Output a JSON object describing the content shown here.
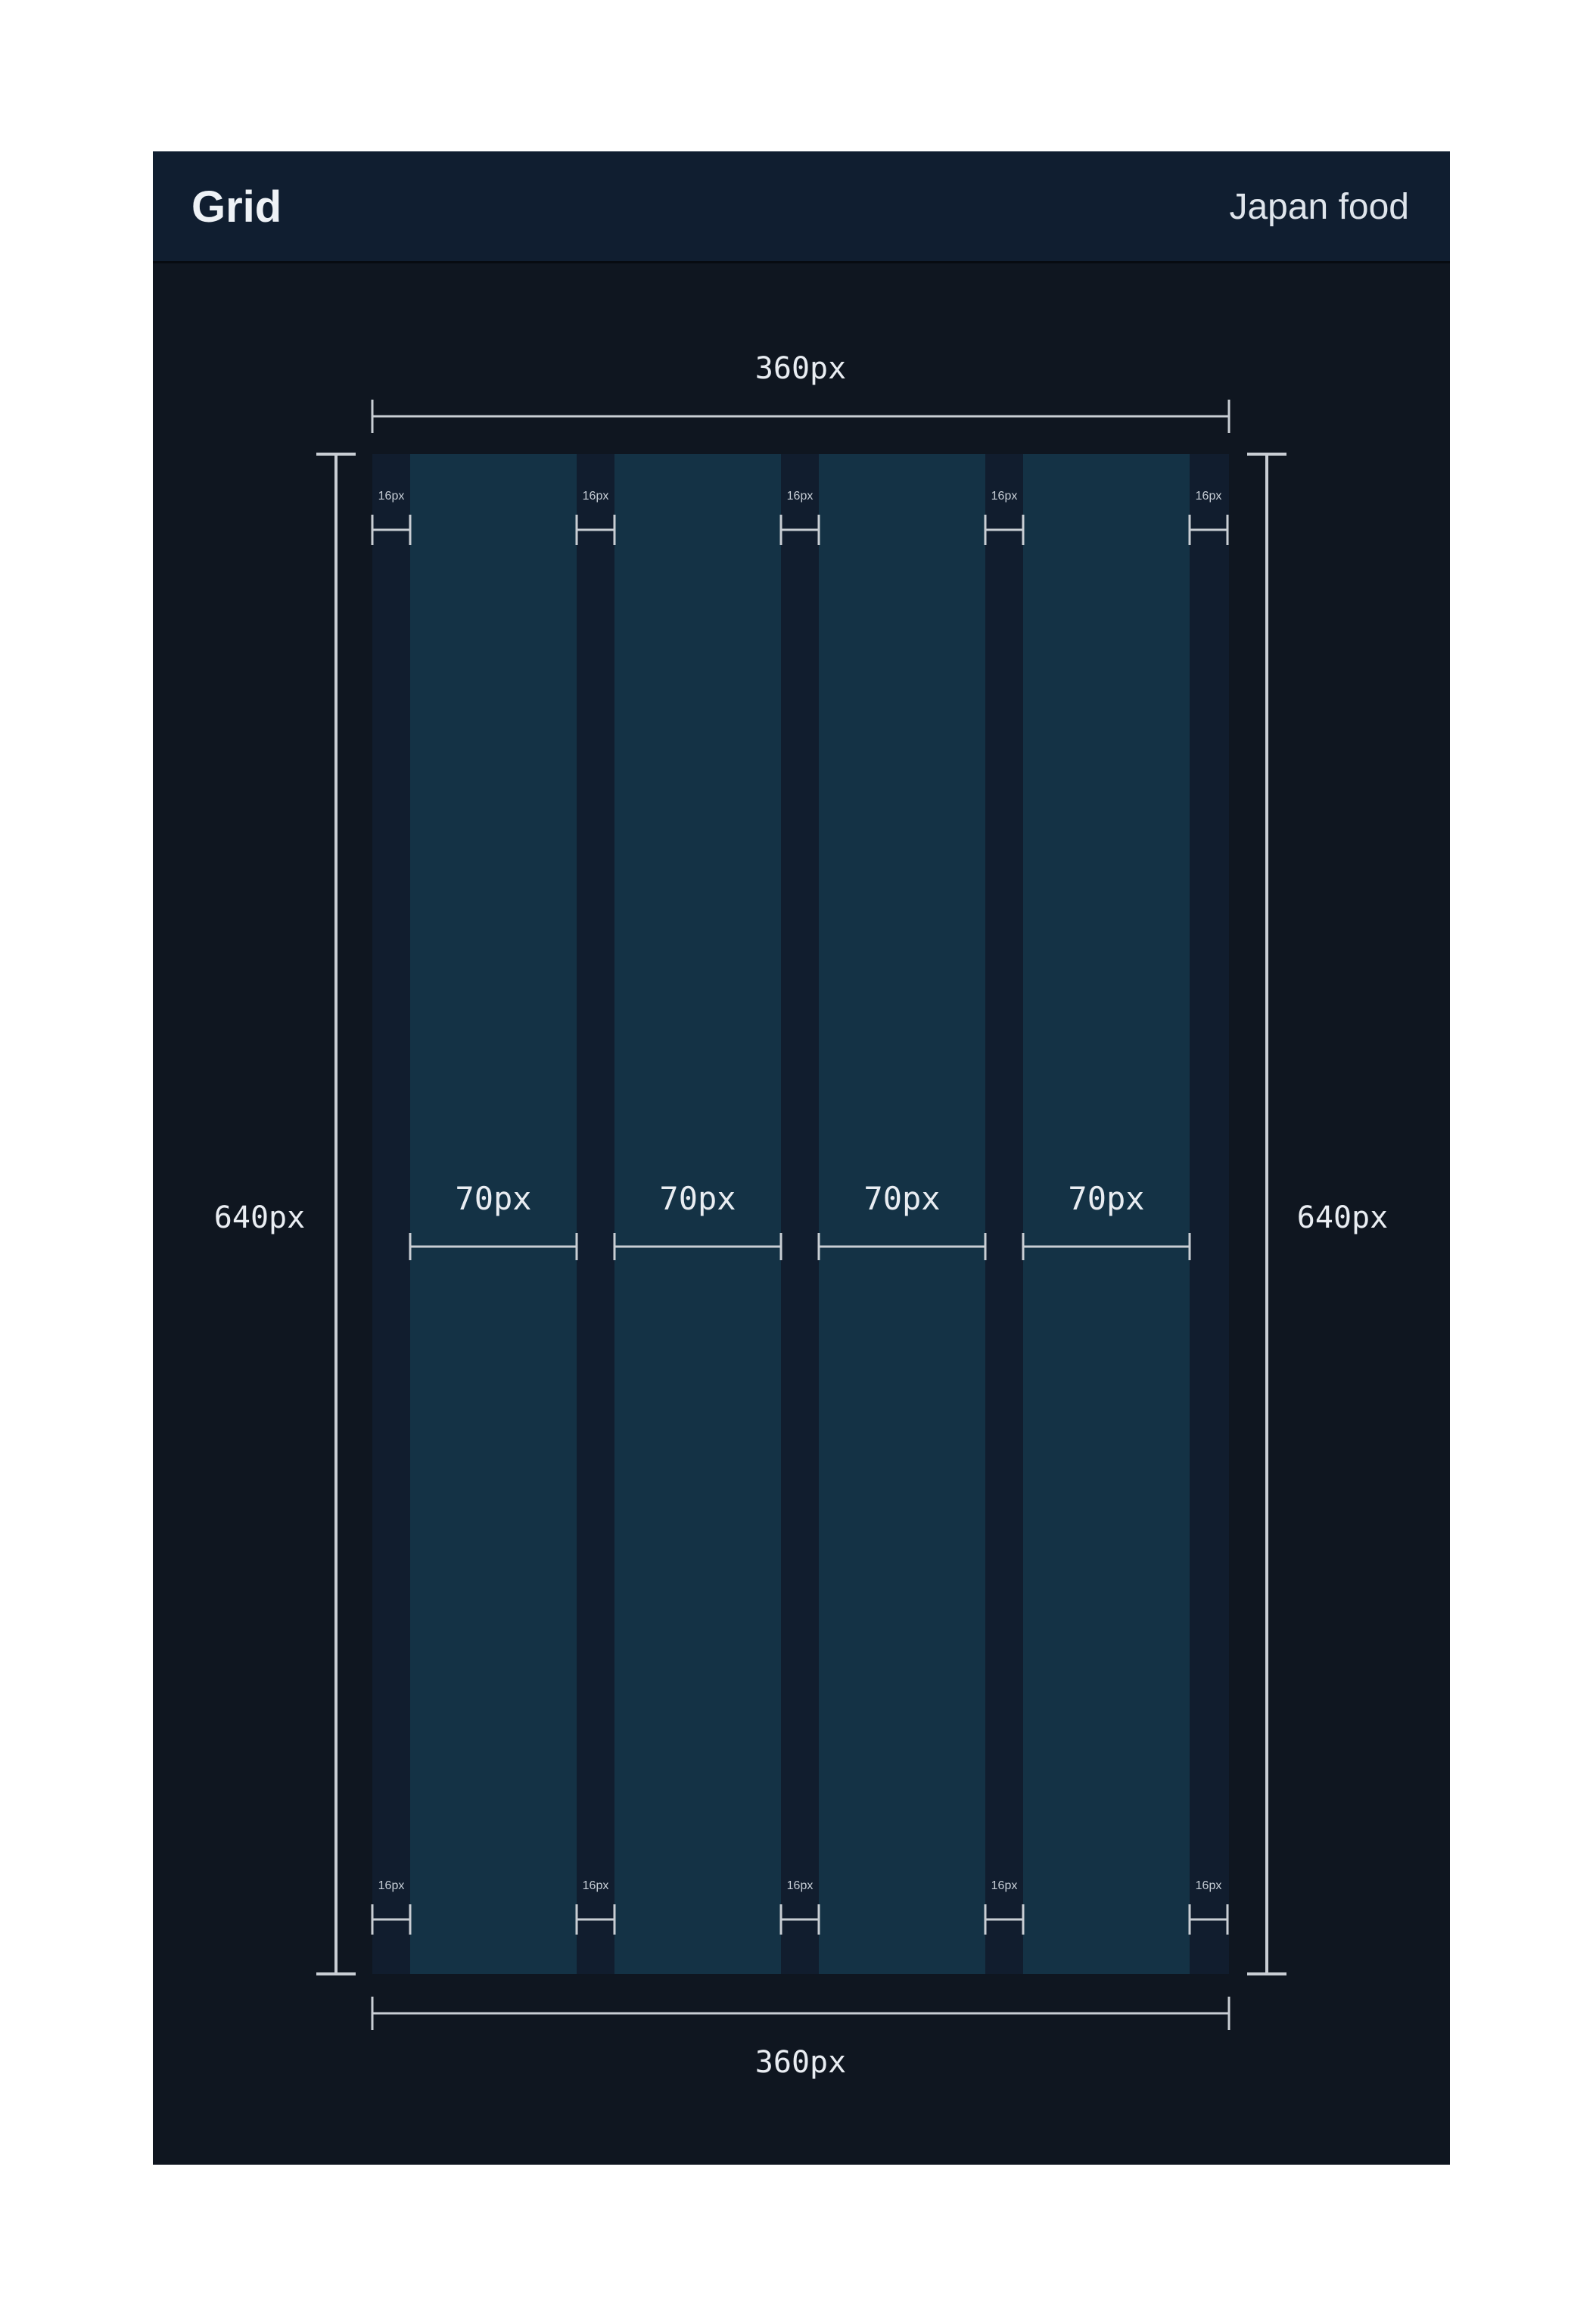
{
  "header": {
    "title": "Grid",
    "subtitle": "Japan food"
  },
  "diagram": {
    "width_label": "360px",
    "height_label": "640px",
    "gutter_label": "16px",
    "columns": [
      {
        "label": "70px"
      },
      {
        "label": "70px"
      },
      {
        "label": "70px"
      },
      {
        "label": "70px"
      }
    ],
    "gutter_count": 5
  },
  "colors": {
    "page_bg": "#ffffff",
    "card_bg": "#0f1620",
    "header_bg": "#101e30",
    "screen_bg": "#111d2e",
    "column_fill": "#143245",
    "dimension_line": "#c9ced4",
    "text": "#e9edf2"
  }
}
